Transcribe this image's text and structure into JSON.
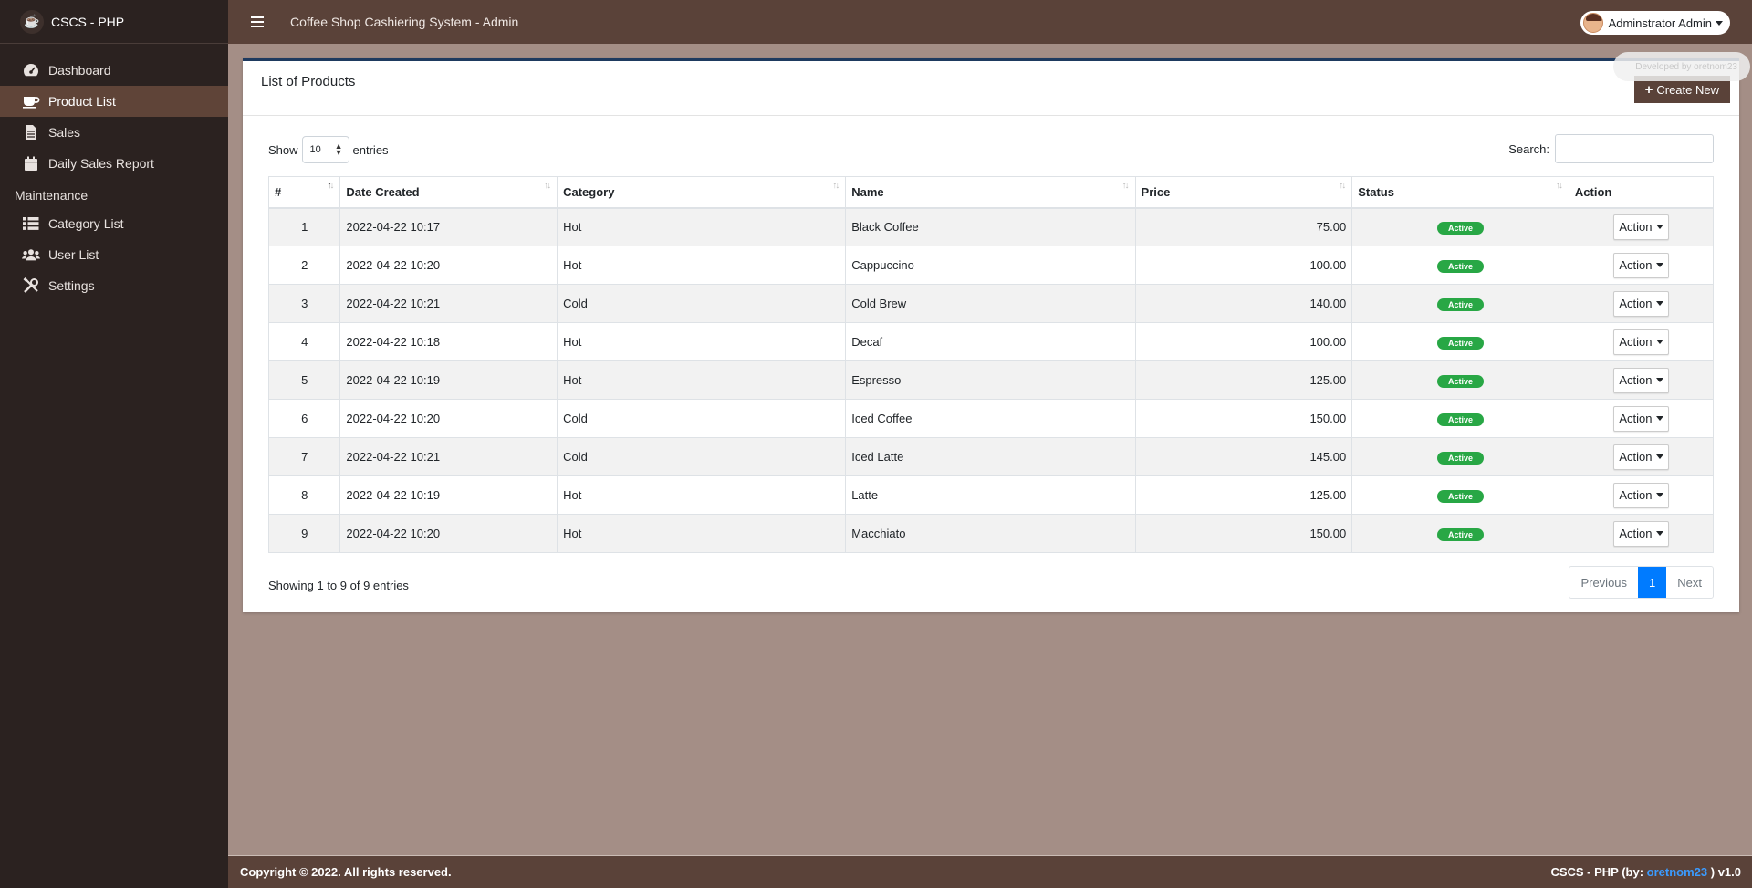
{
  "brand": {
    "name": "CSCS - PHP"
  },
  "topbar": {
    "title": "Coffee Shop Cashiering System - Admin",
    "user": "Adminstrator Admin"
  },
  "sidebar": {
    "items": [
      {
        "label": "Dashboard",
        "icon": "dashboard-icon"
      },
      {
        "label": "Product List",
        "icon": "coffee-cup-icon",
        "active": true
      },
      {
        "label": "Sales",
        "icon": "file-icon"
      },
      {
        "label": "Daily Sales Report",
        "icon": "calendar-icon"
      }
    ],
    "maintenance_header": "Maintenance",
    "maintenance_items": [
      {
        "label": "Category List",
        "icon": "table-list-icon"
      },
      {
        "label": "User List",
        "icon": "users-icon"
      },
      {
        "label": "Settings",
        "icon": "tools-icon"
      }
    ]
  },
  "card": {
    "title": "List of Products",
    "create_label": "Create New",
    "dev_badge": "Developed by oretnom23"
  },
  "datatable": {
    "show_label": "Show",
    "length_value": "10",
    "entries_label": "entries",
    "search_label": "Search:",
    "search_value": "",
    "columns": [
      "#",
      "Date Created",
      "Category",
      "Name",
      "Price",
      "Status",
      "Action"
    ],
    "rows": [
      {
        "num": "1",
        "date": "2022-04-22 10:17",
        "category": "Hot",
        "name": "Black Coffee",
        "price": "75.00",
        "status": "Active",
        "action": "Action"
      },
      {
        "num": "2",
        "date": "2022-04-22 10:20",
        "category": "Hot",
        "name": "Cappuccino",
        "price": "100.00",
        "status": "Active",
        "action": "Action"
      },
      {
        "num": "3",
        "date": "2022-04-22 10:21",
        "category": "Cold",
        "name": "Cold Brew",
        "price": "140.00",
        "status": "Active",
        "action": "Action"
      },
      {
        "num": "4",
        "date": "2022-04-22 10:18",
        "category": "Hot",
        "name": "Decaf",
        "price": "100.00",
        "status": "Active",
        "action": "Action"
      },
      {
        "num": "5",
        "date": "2022-04-22 10:19",
        "category": "Hot",
        "name": "Espresso",
        "price": "125.00",
        "status": "Active",
        "action": "Action"
      },
      {
        "num": "6",
        "date": "2022-04-22 10:20",
        "category": "Cold",
        "name": "Iced Coffee",
        "price": "150.00",
        "status": "Active",
        "action": "Action"
      },
      {
        "num": "7",
        "date": "2022-04-22 10:21",
        "category": "Cold",
        "name": "Iced Latte",
        "price": "145.00",
        "status": "Active",
        "action": "Action"
      },
      {
        "num": "8",
        "date": "2022-04-22 10:19",
        "category": "Hot",
        "name": "Latte",
        "price": "125.00",
        "status": "Active",
        "action": "Action"
      },
      {
        "num": "9",
        "date": "2022-04-22 10:20",
        "category": "Hot",
        "name": "Macchiato",
        "price": "150.00",
        "status": "Active",
        "action": "Action"
      }
    ],
    "info": "Showing 1 to 9 of 9 entries",
    "pagination": {
      "previous": "Previous",
      "current": "1",
      "next": "Next"
    }
  },
  "footer": {
    "copyright": "Copyright © 2022. All rights reserved.",
    "credit_prefix": "CSCS - PHP (by: ",
    "credit_link": "oretnom23",
    "credit_suffix": " ) v1.0"
  },
  "colors": {
    "sidebar_bg": "#2b2220",
    "topbar_bg": "#5a4239",
    "active_item": "#5f4438",
    "page_bg": "#a48e86",
    "status_active": "#28a745",
    "pagination_current": "#007bff"
  }
}
